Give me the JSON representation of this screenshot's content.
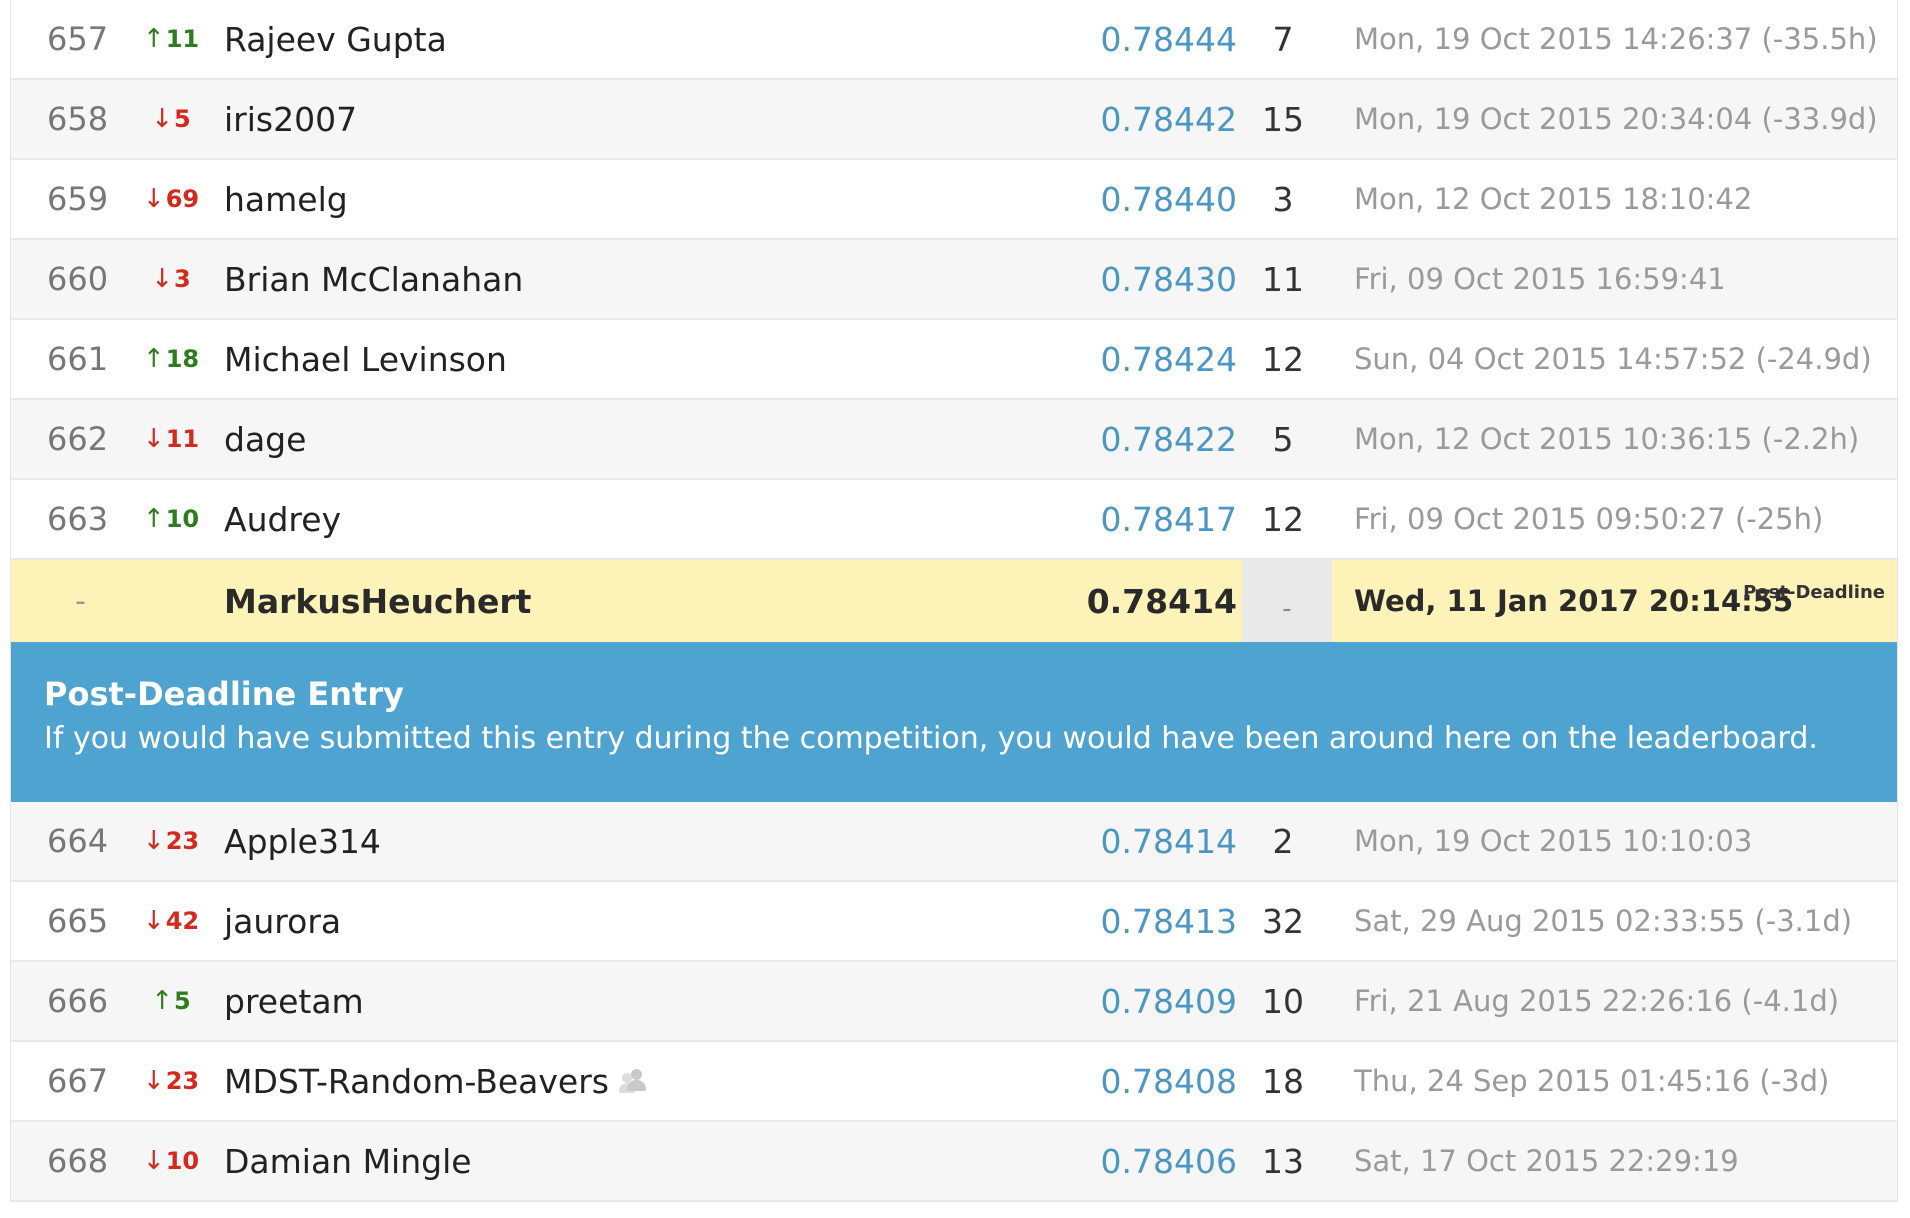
{
  "rows_before": [
    {
      "rank": "657",
      "dir": "up",
      "delta": "11",
      "name": "Rajeev Gupta",
      "score": "0.78444",
      "entries": "7",
      "time": "Mon, 19 Oct 2015 14:26:37 (-35.5h)",
      "team": false
    },
    {
      "rank": "658",
      "dir": "down",
      "delta": "5",
      "name": "iris2007",
      "score": "0.78442",
      "entries": "15",
      "time": "Mon, 19 Oct 2015 20:34:04 (-33.9d)",
      "team": false
    },
    {
      "rank": "659",
      "dir": "down",
      "delta": "69",
      "name": "hamelg",
      "score": "0.78440",
      "entries": "3",
      "time": "Mon, 12 Oct 2015 18:10:42",
      "team": false
    },
    {
      "rank": "660",
      "dir": "down",
      "delta": "3",
      "name": "Brian McClanahan",
      "score": "0.78430",
      "entries": "11",
      "time": "Fri, 09 Oct 2015 16:59:41",
      "team": false
    },
    {
      "rank": "661",
      "dir": "up",
      "delta": "18",
      "name": "Michael Levinson",
      "score": "0.78424",
      "entries": "12",
      "time": "Sun, 04 Oct 2015 14:57:52 (-24.9d)",
      "team": false
    },
    {
      "rank": "662",
      "dir": "down",
      "delta": "11",
      "name": "dage",
      "score": "0.78422",
      "entries": "5",
      "time": "Mon, 12 Oct 2015 10:36:15 (-2.2h)",
      "team": false
    },
    {
      "rank": "663",
      "dir": "up",
      "delta": "10",
      "name": "Audrey",
      "score": "0.78417",
      "entries": "12",
      "time": "Fri, 09 Oct 2015 09:50:27 (-25h)",
      "team": false
    }
  ],
  "post_entry": {
    "rank": "-",
    "name": "MarkusHeuchert",
    "score": "0.78414",
    "entries": "-",
    "time": "Wed, 11 Jan 2017 20:14:55",
    "tag": "Post-Deadline"
  },
  "banner": {
    "title": "Post-Deadline Entry",
    "text": "If you would have submitted this entry during the competition, you would have been around here on the leaderboard."
  },
  "rows_after": [
    {
      "rank": "664",
      "dir": "down",
      "delta": "23",
      "name": "Apple314",
      "score": "0.78414",
      "entries": "2",
      "time": "Mon, 19 Oct 2015 10:10:03",
      "team": false
    },
    {
      "rank": "665",
      "dir": "down",
      "delta": "42",
      "name": "jaurora",
      "score": "0.78413",
      "entries": "32",
      "time": "Sat, 29 Aug 2015 02:33:55 (-3.1d)",
      "team": false
    },
    {
      "rank": "666",
      "dir": "up",
      "delta": "5",
      "name": "preetam",
      "score": "0.78409",
      "entries": "10",
      "time": "Fri, 21 Aug 2015 22:26:16 (-4.1d)",
      "team": false
    },
    {
      "rank": "667",
      "dir": "down",
      "delta": "23",
      "name": "MDST-Random-Beavers",
      "score": "0.78408",
      "entries": "18",
      "time": "Thu, 24 Sep 2015 01:45:16 (-3d)",
      "team": true
    },
    {
      "rank": "668",
      "dir": "down",
      "delta": "10",
      "name": "Damian Mingle",
      "score": "0.78406",
      "entries": "13",
      "time": "Sat, 17 Oct 2015 22:29:19",
      "team": false
    }
  ],
  "icons": {
    "up": "arrow-up-icon",
    "down": "arrow-down-icon",
    "team": "team-icon"
  },
  "colors": {
    "up": "#2e7d1d",
    "down": "#d42a1e",
    "score": "#4b96c3",
    "highlight": "#fdf2b8",
    "banner": "#4fa3d1"
  }
}
